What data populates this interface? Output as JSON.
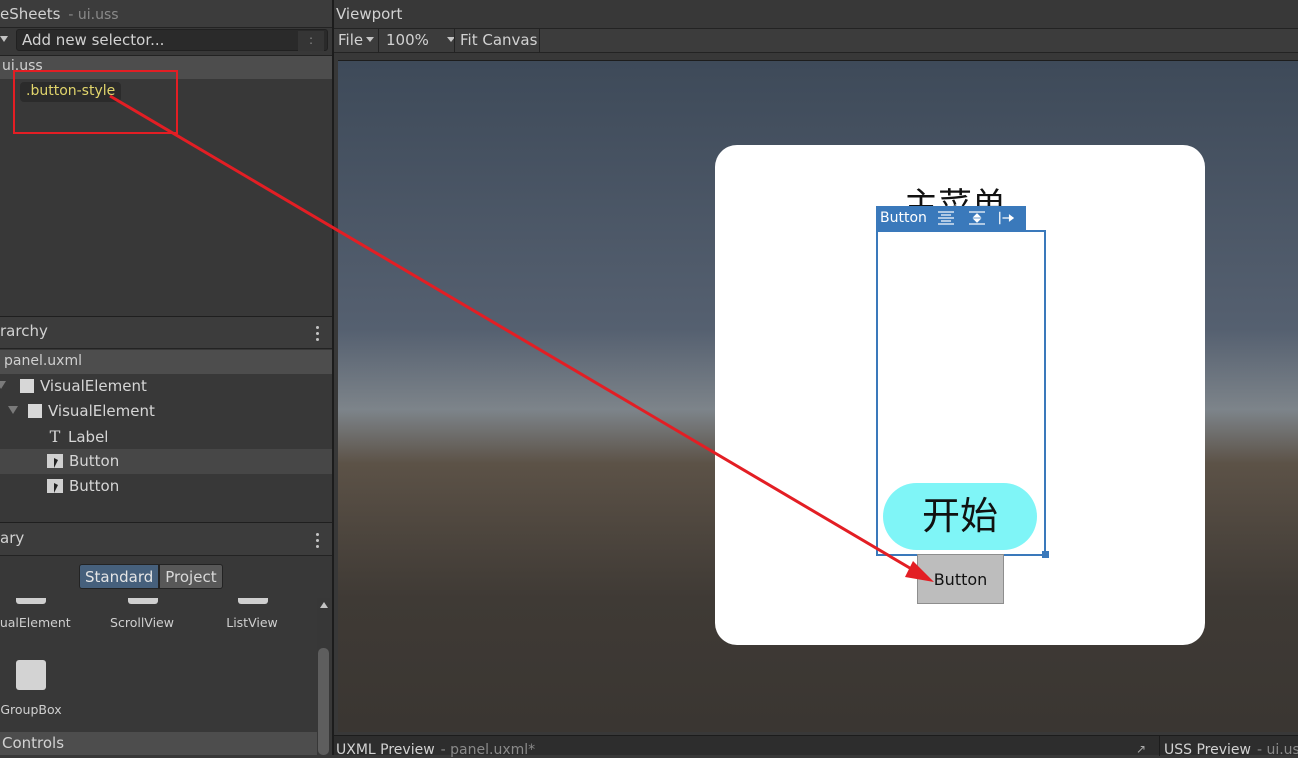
{
  "stylesheets": {
    "title": "eSheets",
    "file": "- ui.uss",
    "add_selector_placeholder": "Add new selector...",
    "more_symbol": ":",
    "uss_file": "ui.uss",
    "selector": ".button-style"
  },
  "hierarchy": {
    "title": "rarchy",
    "file": "panel.uxml",
    "items": [
      {
        "label": "VisualElement",
        "icon": "visual-element-icon"
      },
      {
        "label": "VisualElement",
        "icon": "visual-element-icon"
      },
      {
        "label": "Label",
        "icon": "text-t-icon",
        "glyph": "T"
      },
      {
        "label": "Button",
        "icon": "button-icon",
        "selected": true
      },
      {
        "label": "Button",
        "icon": "button-icon"
      }
    ]
  },
  "library": {
    "title": "ary",
    "tabs": [
      {
        "label": "Standard",
        "active": true
      },
      {
        "label": "Project",
        "active": false
      }
    ],
    "items": [
      "sualElement",
      "ScrollView",
      "ListView",
      "GroupBox"
    ],
    "section": "Controls"
  },
  "viewport": {
    "title": "Viewport",
    "toolbar": {
      "file": "File",
      "zoom": "100%",
      "fit_canvas": "Fit Canvas"
    },
    "canvas": {
      "menu_title": "主菜单",
      "selected_tag": "Button",
      "start_button": "开始",
      "plain_button": "Button"
    },
    "bottom": {
      "uxml_preview": "UXML Preview",
      "uxml_file": "- panel.uxml*",
      "uss_preview": "USS Preview",
      "uss_file": "- ui.uss"
    }
  },
  "colors": {
    "selection_blue": "#3a79bb",
    "start_button": "#7ff5f7",
    "annotation_red": "#e31e24",
    "selector_text": "#e1d56c"
  }
}
